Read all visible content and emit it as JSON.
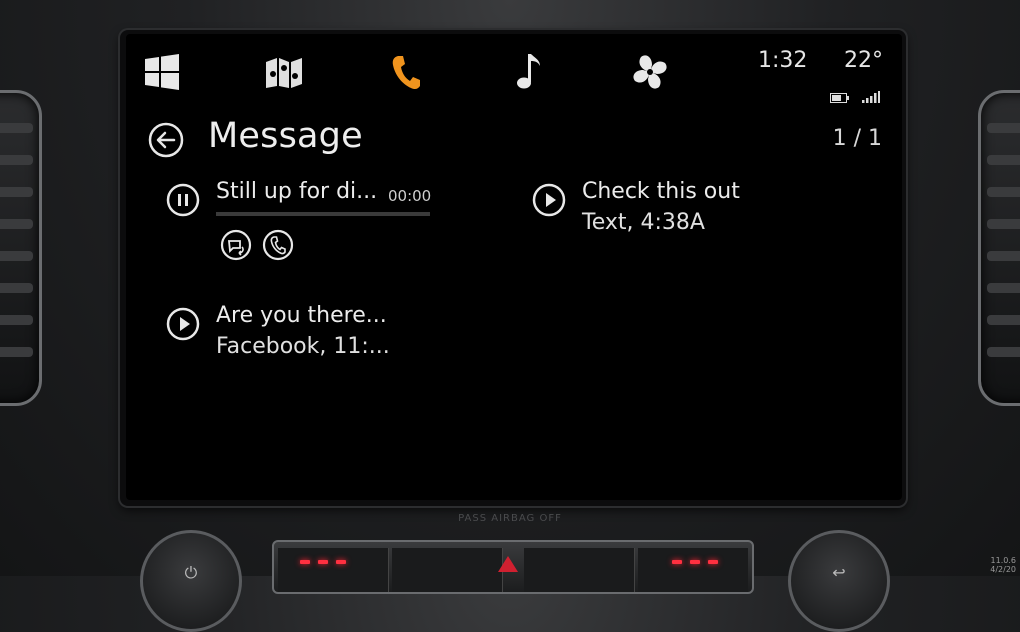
{
  "status": {
    "time": "1:32",
    "temperature": "22°"
  },
  "nav": [
    {
      "name": "start",
      "icon": "windows-logo-icon",
      "active": false
    },
    {
      "name": "maps",
      "icon": "map-icon",
      "active": false
    },
    {
      "name": "phone",
      "icon": "phone-icon",
      "active": true
    },
    {
      "name": "music",
      "icon": "music-note-icon",
      "active": false
    },
    {
      "name": "climate",
      "icon": "fan-icon",
      "active": false
    }
  ],
  "header": {
    "title": "Message",
    "pager": "1 / 1"
  },
  "messages": [
    {
      "preview": "Still up for di...",
      "elapsed": "00:00",
      "state": "playing",
      "progress": 0
    },
    {
      "preview": "Check this out",
      "meta": "Text, 4:38A",
      "state": "paused"
    },
    {
      "preview": "Are you there...",
      "meta": "Facebook, 11:...",
      "state": "paused"
    }
  ],
  "dash": {
    "airbag_label": "PASS AIRBAG OFF",
    "version": "11.0.6\n4/2/20"
  },
  "colors": {
    "accent": "#f0941e",
    "text": "#ececec",
    "background": "#000000"
  }
}
